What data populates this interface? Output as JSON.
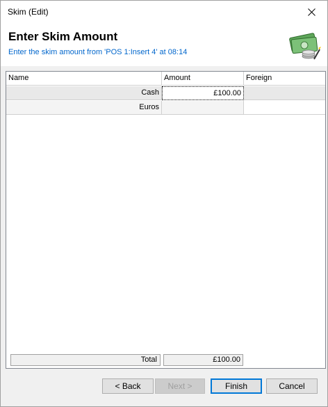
{
  "window": {
    "title": "Skim (Edit)"
  },
  "header": {
    "title": "Enter Skim Amount",
    "subtitle": "Enter the skim amount from 'POS 1:Insert 4' at 08:14",
    "icon": "money-cash-icon"
  },
  "grid": {
    "columns": [
      "Name",
      "Amount",
      "Foreign"
    ],
    "rows": [
      {
        "name": "Cash",
        "amount": "£100.00",
        "foreign": ""
      },
      {
        "name": "Euros",
        "amount": "",
        "foreign": ""
      }
    ]
  },
  "totals": {
    "label": "Total",
    "value": "£100.00"
  },
  "buttons": {
    "back": "< Back",
    "next": "Next >",
    "finish": "Finish",
    "cancel": "Cancel"
  },
  "colors": {
    "subtitle": "#0066cc",
    "focus": "#0078d7"
  }
}
